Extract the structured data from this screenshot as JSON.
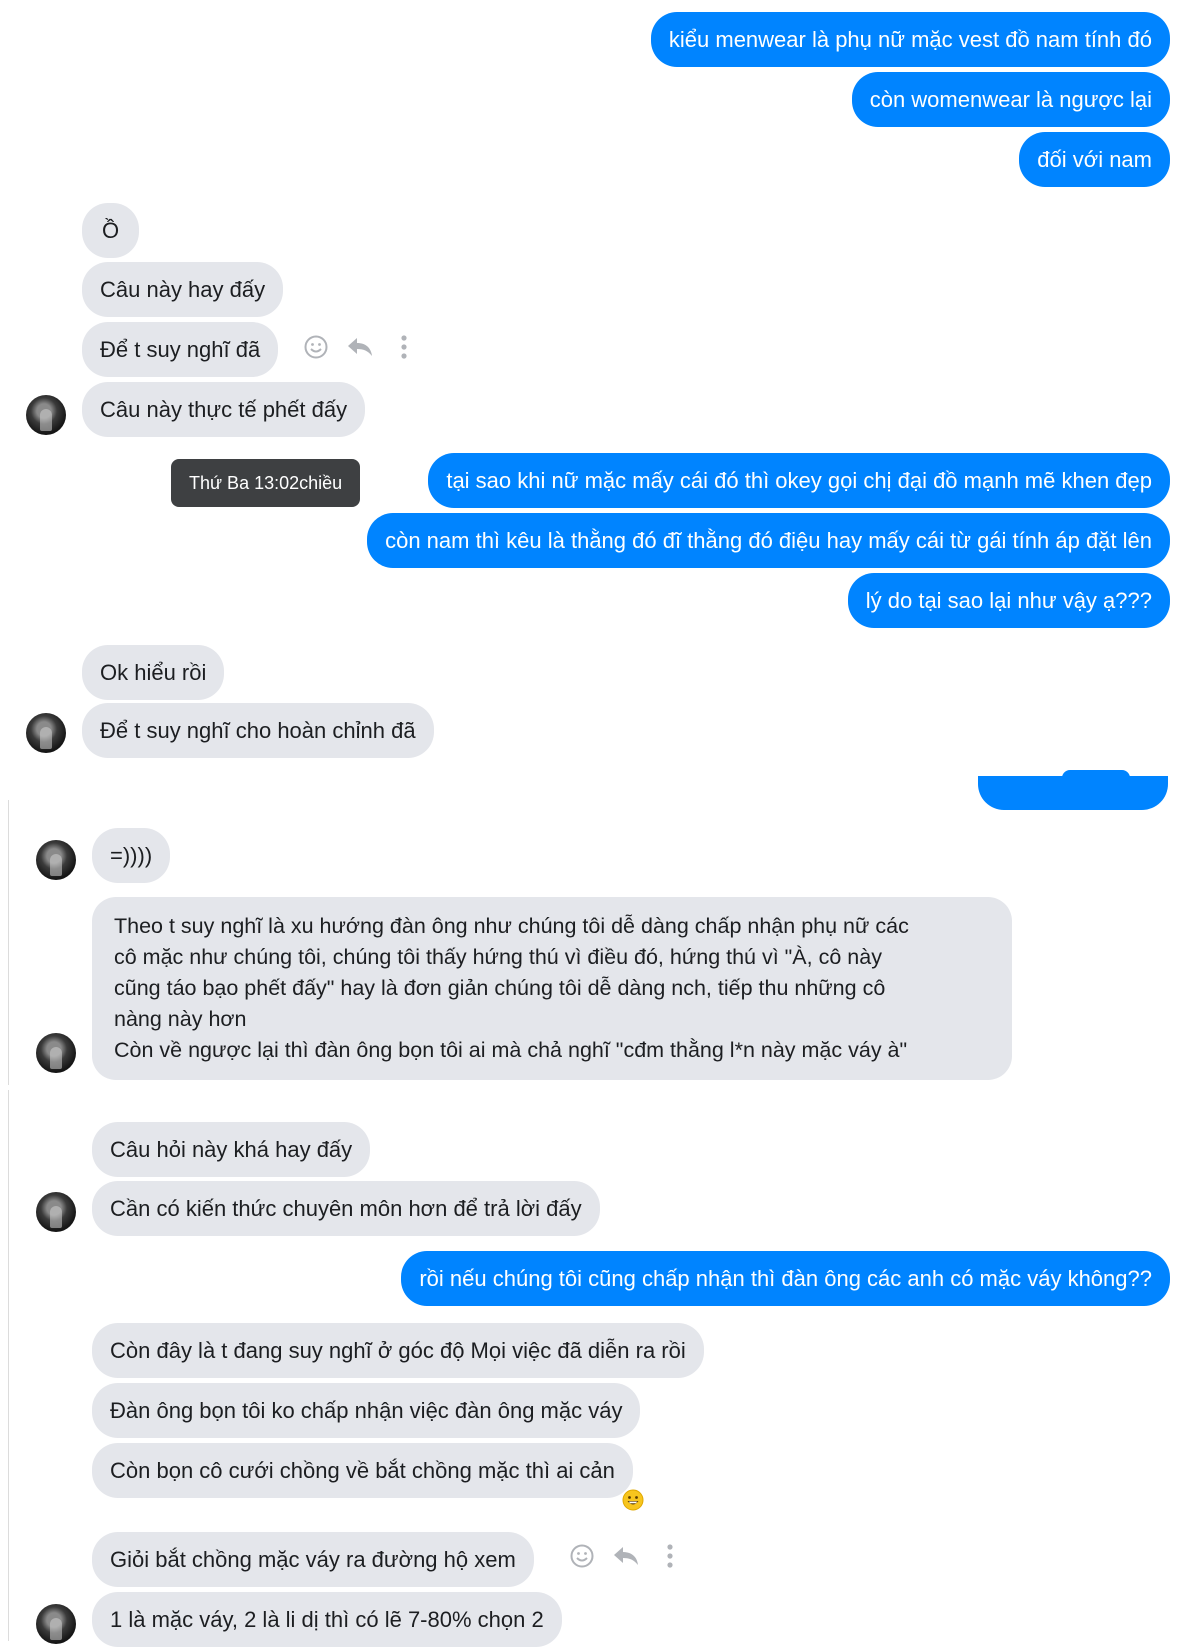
{
  "messages": {
    "m1": "kiểu menwear là phụ nữ mặc vest đồ nam tính đó",
    "m2": "còn womenwear là ngược lại",
    "m3": "đối với nam",
    "t1": "Ồ",
    "t2": "Câu này hay đấy",
    "t3": "Để t suy nghĩ đã",
    "t4": "Câu này thực tế phết đấy",
    "m4": "tại sao khi nữ mặc mấy cái đó thì okey gọi chị đại đồ mạnh mẽ khen đẹp",
    "m5": "còn nam thì kêu là thằng đó đĩ thằng đó điệu hay mấy cái từ gái tính áp đặt lên",
    "m6": "lý do tại sao lại như vậy ạ???",
    "t5": "Ok hiểu rồi",
    "t6": "Để t suy nghĩ cho hoàn chỉnh đã",
    "t7": "=))))",
    "t8_lines": [
      "Theo t suy nghĩ là xu hướng đàn ông như chúng tôi dễ dàng chấp nhận phụ nữ các",
      "cô mặc như chúng tôi, chúng tôi thấy hứng thú vì điều đó, hứng thú vì \"À, cô này",
      "cũng táo bạo phết đấy\" hay là đơn giản chúng tôi dễ dàng nch, tiếp thu những cô",
      "nàng này hơn",
      "Còn về ngược lại thì đàn ông bọn tôi ai mà chả nghĩ \"cđm thằng l*n này mặc váy à\""
    ],
    "t9": "Câu hỏi này khá hay đấy",
    "t10": "Cần có kiến thức chuyên môn hơn để trả lời đấy",
    "m7": "rồi nếu chúng tôi cũng chấp nhận thì đàn ông các anh có mặc váy không??",
    "t11": "Còn đây là t đang suy nghĩ ở góc độ Mọi việc đã diễn ra rồi",
    "t12": "Đàn ông bọn tôi ko chấp nhận việc đàn ông mặc váy",
    "t13": "Còn bọn cô cưới chồng về bắt chồng mặc thì ai cản",
    "t14": "Giỏi bắt chồng mặc váy ra đường hộ xem",
    "t15": "1 là mặc váy, 2 là li dị thì có lẽ 7-80% chọn 2"
  },
  "tooltip": "Thứ Ba 13:02chiều",
  "reaction_emoji": "grinning-face",
  "colors": {
    "sent": "#0084ff",
    "received": "#e4e6eb",
    "tooltip": "#3e4042"
  },
  "icons": [
    "smiley-icon",
    "reply-icon",
    "more-icon"
  ]
}
